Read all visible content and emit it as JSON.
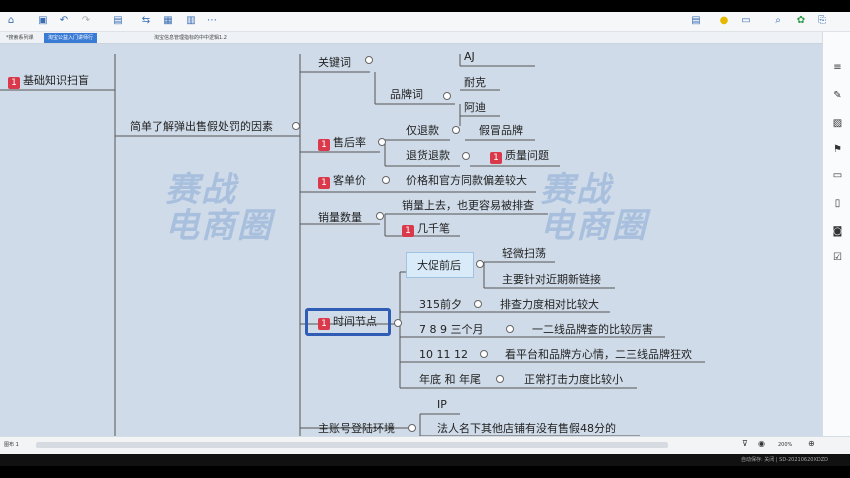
{
  "toolbar": {
    "zoom": "200%"
  },
  "tabs": [
    {
      "label": "*搜索系列课"
    },
    {
      "label": "淘宝公益入门讲师行"
    },
    {
      "label": "淘宝信息管理指标的中中逻辑1.2"
    }
  ],
  "mindmap": {
    "left_node": "基础知识扫盲",
    "left_badge": "1",
    "center_node": "简单了解弹出售假处罚的因素",
    "keyword": "关键词",
    "brand_word": "品牌词",
    "nike": "耐克",
    "adidas": "阿迪",
    "aj": "AJ",
    "after_sales": "售后率",
    "refund_only": "仅退款",
    "fake_brand": "假冒品牌",
    "return_refund": "退货退款",
    "quality_issue": "质量问题",
    "unit_price": "客单价",
    "price_gap": "价格和官方同款偏差较大",
    "sales_volume": "销量数量",
    "sales_up": "销量上去，也更容易被排查",
    "thousands": "几千笔",
    "time_node": "时间节点",
    "big_promo": "大促前后",
    "light_sweep": "轻微扫荡",
    "new_links": "主要针对近期新链接",
    "m315": "315前夕",
    "m315_desc": "排查力度相对比较大",
    "m789": "7  8  9   三个月",
    "m789_desc": "一二线品牌查的比较厉害",
    "m101112": "10  11  12",
    "m101112_desc": "看平台和品牌方心情，二三线品牌狂欢",
    "yearend": "年底  和  年尾",
    "yearend_desc": "正常打击力度比较小",
    "main_account": "主账号登陆环境",
    "ip": "IP",
    "legal_person": "法人名下其他店铺有没有售假48分的",
    "badge": "1"
  },
  "watermark": {
    "line1": "赛战",
    "line2": "电商圈"
  },
  "status": {
    "left": "图布 1",
    "right": "自动保存: 关闭  |  SD-20210620XDZD"
  }
}
